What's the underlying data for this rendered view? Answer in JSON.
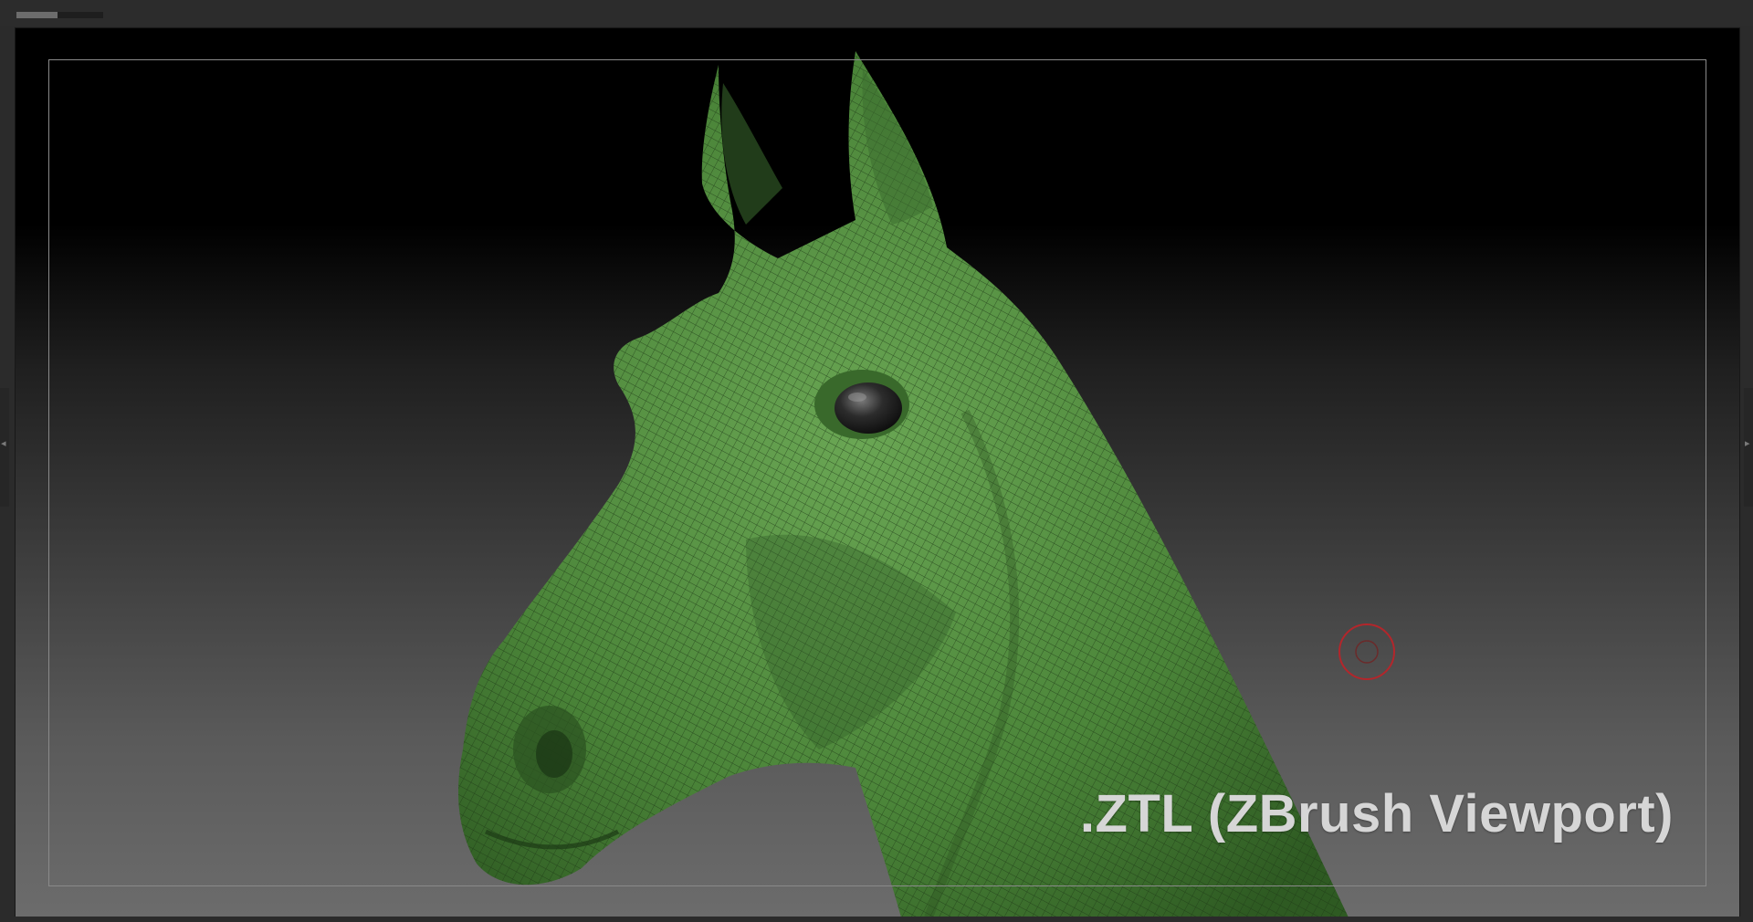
{
  "window": {
    "title": ""
  },
  "topbar": {
    "progress_fraction": 0.47
  },
  "viewport": {
    "label": ".ZTL (ZBrush Viewport)",
    "model_color": "#4f8a3c",
    "eye_color": "#2a2a2a",
    "brush_cursor_color": "#c0262c"
  },
  "icons": {
    "left_handle": "collapse-left-icon",
    "right_handle": "collapse-right-icon",
    "cursor": "brush-cursor-icon"
  }
}
